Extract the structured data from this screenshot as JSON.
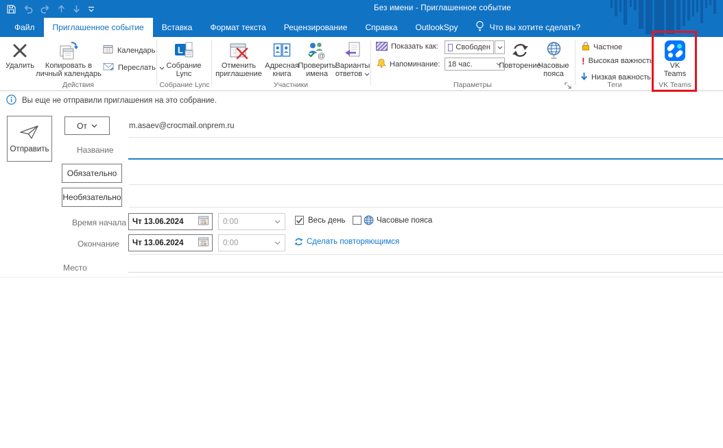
{
  "titlebar": {
    "title": "Без имени - Приглашенное событие"
  },
  "tabs": {
    "file": "Файл",
    "event": "Приглашенное событие",
    "insert": "Вставка",
    "format": "Формат текста",
    "review": "Рецензирование",
    "help": "Справка",
    "outlookspy": "OutlookSpy",
    "tellme": "Что вы хотите сделать?"
  },
  "ribbon": {
    "actions": {
      "label": "Действия",
      "delete": "Удалить",
      "copy_to_personal": "Копировать в личный календарь",
      "calendar": "Календарь",
      "forward": "Переслать"
    },
    "lync": {
      "label": "Собрание Lync",
      "button": "Собрание Lync"
    },
    "attendees": {
      "label": "Участники",
      "cancel_invitation": "Отменить приглашение",
      "address_book": "Адресная книга",
      "check_names": "Проверить имена",
      "response_options": "Варианты ответов"
    },
    "options": {
      "label": "Параметры",
      "show_as": "Показать как:",
      "show_as_value": "Свободен",
      "reminder": "Напоминание:",
      "reminder_value": "18 час.",
      "recurrence": "Повторение",
      "time_zones": "Часовые пояса"
    },
    "tags": {
      "label": "Теги",
      "private": "Частное",
      "high_importance": "Высокая важность",
      "low_importance": "Низкая важность"
    },
    "vk_teams": {
      "label": "VK Teams",
      "button": "VK Teams"
    }
  },
  "infobar": {
    "message": "Вы еще не отправили приглашения на это собрание."
  },
  "form": {
    "send": "Отправить",
    "from": "От",
    "from_address": "m.asaev@crocmail.onprem.ru",
    "title": "Название",
    "required": "Обязательно",
    "optional": "Необязательно",
    "start": "Время начала",
    "end": "Окончание",
    "start_date": "Чт 13.06.2024",
    "start_time": "0:00",
    "end_date": "Чт 13.06.2024",
    "end_time": "0:00",
    "all_day": "Весь день",
    "time_zones": "Часовые пояса",
    "make_recurring": "Сделать повторяющимся",
    "location": "Место"
  },
  "colors": {
    "titlebar": "#1173c4",
    "accent": "#0f7bd0",
    "annotation": "#e8141e",
    "vk_icon": "#0077ff"
  }
}
